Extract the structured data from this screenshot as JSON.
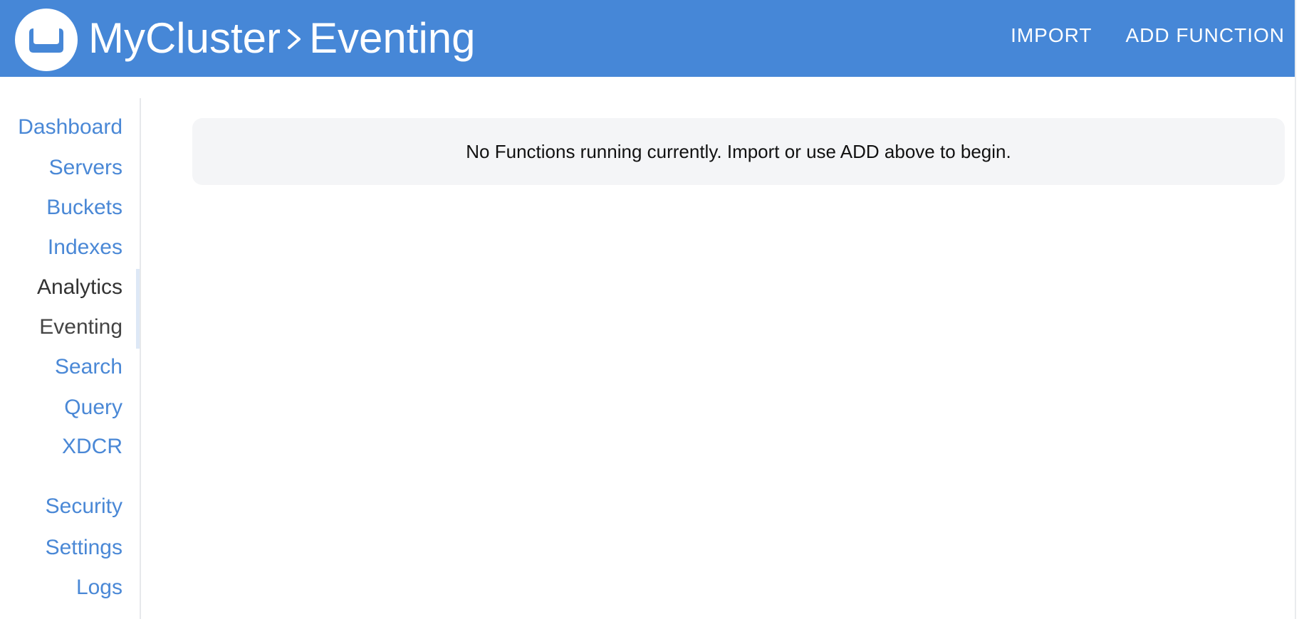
{
  "header": {
    "cluster_name": "MyCluster",
    "separator_icon": "chevron-right-icon",
    "page_name": "Eventing",
    "logo_icon": "couchbase-logo-icon",
    "actions": {
      "import_label": "IMPORT",
      "add_function_label": "ADD FUNCTION"
    }
  },
  "sidebar": {
    "items": [
      {
        "label": "Dashboard"
      },
      {
        "label": "Servers"
      },
      {
        "label": "Buckets"
      },
      {
        "label": "Indexes"
      },
      {
        "label": "Analytics"
      },
      {
        "label": "Eventing"
      },
      {
        "label": "Search"
      },
      {
        "label": "Query"
      },
      {
        "label": "XDCR"
      },
      {
        "label": "Security"
      },
      {
        "label": "Settings"
      },
      {
        "label": "Logs"
      }
    ],
    "active_item": "Eventing"
  },
  "main": {
    "empty_message": "No Functions running currently. Import or use ADD above to begin."
  },
  "colors": {
    "header_bg": "#4687d7",
    "link_blue": "#4a88d6",
    "panel_bg": "#f4f5f7"
  }
}
